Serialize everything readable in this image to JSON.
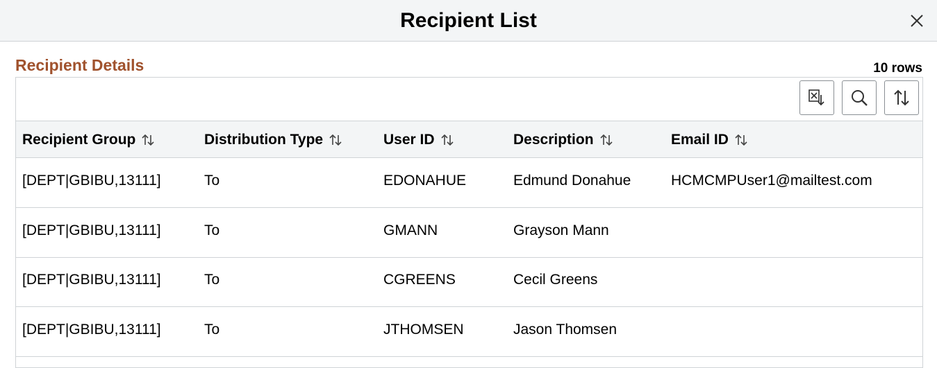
{
  "modal": {
    "title": "Recipient List"
  },
  "section": {
    "title": "Recipient Details",
    "row_count": "10 rows"
  },
  "toolbar": {
    "export_icon": "excel-download-icon",
    "find_icon": "search-icon",
    "sort_icon": "sort-icon"
  },
  "table": {
    "columns": [
      "Recipient Group",
      "Distribution Type",
      "User ID",
      "Description",
      "Email ID"
    ],
    "rows": [
      [
        "[DEPT|GBIBU,13111]",
        "To",
        "EDONAHUE",
        "Edmund Donahue",
        "HCMCMPUser1@mailtest.com"
      ],
      [
        "[DEPT|GBIBU,13111]",
        "To",
        "GMANN",
        "Grayson Mann",
        ""
      ],
      [
        "[DEPT|GBIBU,13111]",
        "To",
        "CGREENS",
        "Cecil Greens",
        ""
      ],
      [
        "[DEPT|GBIBU,13111]",
        "To",
        "JTHOMSEN",
        "Jason Thomsen",
        ""
      ]
    ]
  },
  "colors": {
    "section_title": "#a0522d",
    "header_bg": "#f3f5f6",
    "border": "#cfd3d6"
  }
}
